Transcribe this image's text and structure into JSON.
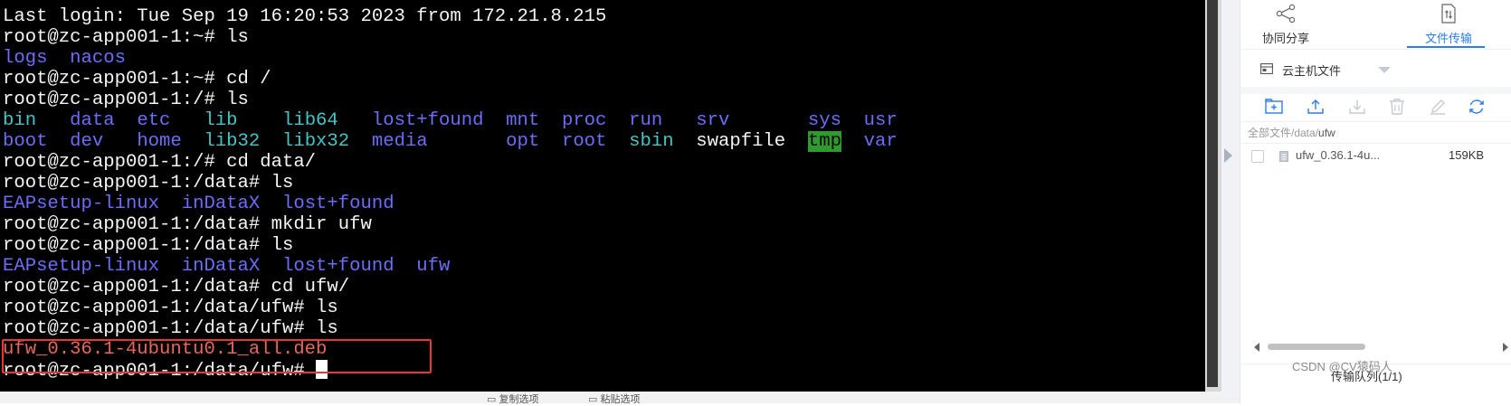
{
  "colors": {
    "terminal_bg": "#000000",
    "text_default": "#f5f5f5",
    "dir_blue": "#6d6df8",
    "cyan": "#41c5c5",
    "deb_red": "#e8665a",
    "tmp_highlight_bg": "#2f9b2f",
    "accent": "#2b7de9",
    "highlight_box": "#e53935"
  },
  "terminal": {
    "lines": [
      [
        {
          "t": "Last login: Tue Sep 19 16:20:53 2023 from 172.21.8.215"
        }
      ],
      [
        {
          "t": "root@zc-app001-1:~# ls"
        }
      ],
      [
        {
          "t": "logs",
          "c": "dir"
        },
        {
          "t": "  "
        },
        {
          "t": "nacos",
          "c": "dir"
        }
      ],
      [
        {
          "t": "root@zc-app001-1:~# cd /"
        }
      ],
      [
        {
          "t": "root@zc-app001-1:/# ls"
        }
      ],
      [
        {
          "t": "bin",
          "c": "cyan"
        },
        {
          "t": "   "
        },
        {
          "t": "data",
          "c": "dir"
        },
        {
          "t": "  "
        },
        {
          "t": "etc",
          "c": "dir"
        },
        {
          "t": "   "
        },
        {
          "t": "lib",
          "c": "cyan"
        },
        {
          "t": "    "
        },
        {
          "t": "lib64",
          "c": "cyan"
        },
        {
          "t": "   "
        },
        {
          "t": "lost+found",
          "c": "dir"
        },
        {
          "t": "  "
        },
        {
          "t": "mnt",
          "c": "dir"
        },
        {
          "t": "  "
        },
        {
          "t": "proc",
          "c": "dir"
        },
        {
          "t": "  "
        },
        {
          "t": "run",
          "c": "dir"
        },
        {
          "t": "   "
        },
        {
          "t": "srv",
          "c": "dir"
        },
        {
          "t": "       "
        },
        {
          "t": "sys",
          "c": "dir"
        },
        {
          "t": "  "
        },
        {
          "t": "usr",
          "c": "dir"
        }
      ],
      [
        {
          "t": "boot",
          "c": "dir"
        },
        {
          "t": "  "
        },
        {
          "t": "dev",
          "c": "dir"
        },
        {
          "t": "   "
        },
        {
          "t": "home",
          "c": "dir"
        },
        {
          "t": "  "
        },
        {
          "t": "lib32",
          "c": "cyan"
        },
        {
          "t": "  "
        },
        {
          "t": "libx32",
          "c": "cyan"
        },
        {
          "t": "  "
        },
        {
          "t": "media",
          "c": "dir"
        },
        {
          "t": "       "
        },
        {
          "t": "opt",
          "c": "dir"
        },
        {
          "t": "  "
        },
        {
          "t": "root",
          "c": "dir"
        },
        {
          "t": "  "
        },
        {
          "t": "sbin",
          "c": "cyan"
        },
        {
          "t": "  "
        },
        {
          "t": "swapfile"
        },
        {
          "t": "  "
        },
        {
          "t": "tmp",
          "c": "tmp"
        },
        {
          "t": "  "
        },
        {
          "t": "var",
          "c": "dir"
        }
      ],
      [
        {
          "t": "root@zc-app001-1:/# cd data/"
        }
      ],
      [
        {
          "t": "root@zc-app001-1:/data# ls"
        }
      ],
      [
        {
          "t": "EAPsetup-linux",
          "c": "dir"
        },
        {
          "t": "  "
        },
        {
          "t": "inDataX",
          "c": "dir"
        },
        {
          "t": "  "
        },
        {
          "t": "lost+found",
          "c": "dir"
        }
      ],
      [
        {
          "t": "root@zc-app001-1:/data# mkdir ufw"
        }
      ],
      [
        {
          "t": "root@zc-app001-1:/data# ls"
        }
      ],
      [
        {
          "t": "EAPsetup-linux",
          "c": "dir"
        },
        {
          "t": "  "
        },
        {
          "t": "inDataX",
          "c": "dir"
        },
        {
          "t": "  "
        },
        {
          "t": "lost+found",
          "c": "dir"
        },
        {
          "t": "  "
        },
        {
          "t": "ufw",
          "c": "dir"
        }
      ],
      [
        {
          "t": "root@zc-app001-1:/data# cd ufw/"
        }
      ],
      [
        {
          "t": "root@zc-app001-1:/data/ufw# ls"
        }
      ],
      [
        {
          "t": "root@zc-app001-1:/data/ufw# ls"
        }
      ],
      [
        {
          "t": "ufw_0.36.1-4ubuntu0.1_all.deb",
          "c": "red"
        }
      ],
      [
        {
          "t": "root@zc-app001-1:/data/ufw# "
        },
        {
          "t": "",
          "c": "cursor"
        }
      ]
    ],
    "bottom_bar": {
      "left_text": "复制选项",
      "right_text": "粘贴选项"
    }
  },
  "panel": {
    "tabs": [
      {
        "label": "协同分享",
        "icon": "share-icon"
      },
      {
        "label": "文件传输",
        "icon": "file-transfer-icon"
      }
    ],
    "location": {
      "label": "云主机文件",
      "icon": "server-file-icon"
    },
    "toolbar": [
      {
        "name": "new-folder-icon"
      },
      {
        "name": "upload-icon"
      },
      {
        "name": "download-icon"
      },
      {
        "name": "delete-icon"
      },
      {
        "name": "rename-icon"
      },
      {
        "name": "refresh-icon"
      }
    ],
    "breadcrumb": {
      "prefix": "全部文件/data/",
      "current": "ufw"
    },
    "files": [
      {
        "name": "ufw_0.36.1-4ubuntu0.1_all.deb",
        "display_name": "ufw_0.36.1-4u...",
        "size": "159KB"
      }
    ],
    "queue_label": "传输队列(1/1)"
  },
  "watermark": "CSDN @CV猿码人"
}
